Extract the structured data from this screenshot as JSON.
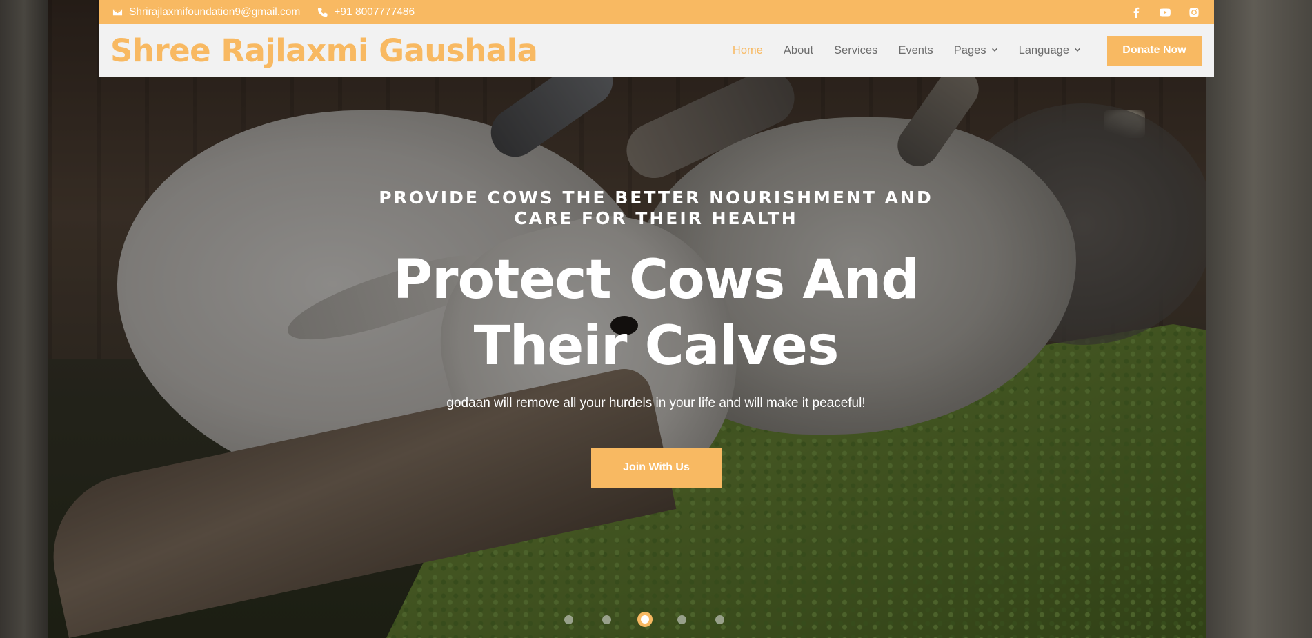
{
  "topbar": {
    "email": "Shrirajlaxmifoundation9@gmail.com",
    "phone": "+91 8007777486",
    "social": [
      "facebook-icon",
      "youtube-icon",
      "instagram-icon"
    ]
  },
  "nav": {
    "brand": "Shree Rajlaxmi Gaushala",
    "items": [
      {
        "label": "Home",
        "active": true
      },
      {
        "label": "About"
      },
      {
        "label": "Services"
      },
      {
        "label": "Events"
      },
      {
        "label": "Pages",
        "dropdown": true
      },
      {
        "label": "Language",
        "dropdown": true
      }
    ],
    "donate_label": "Donate Now"
  },
  "hero": {
    "subtitle": "PROVIDE COWS THE BETTER NOURISHMENT AND CARE FOR THEIR HEALTH",
    "headline": "Protect Cows And Their Calves",
    "tagline": "godaan will remove all your hurdels in your life and will make it peaceful!",
    "button_label": "Join With Us"
  },
  "carousel": {
    "slide_count": 5,
    "active_index": 3
  },
  "colors": {
    "accent": "#f8b962",
    "nav_bg": "#f2f2f2",
    "nav_text": "#6c6c6c"
  }
}
